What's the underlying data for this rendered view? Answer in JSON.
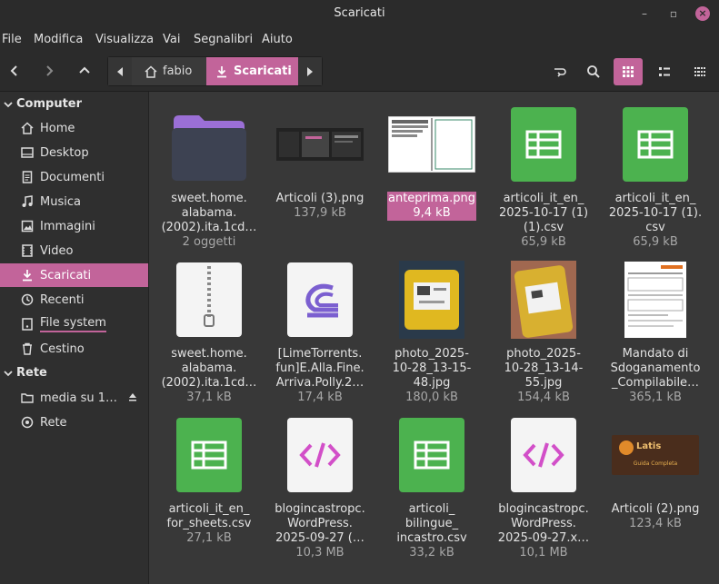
{
  "window": {
    "title": "Scaricati"
  },
  "menu": [
    "File",
    "Modifica",
    "Visualizza",
    "Vai",
    "Segnalibri",
    "Aiuto"
  ],
  "path": {
    "home": "fabio",
    "current": "Scaricati"
  },
  "sidebar": {
    "computer_label": "Computer",
    "items": [
      {
        "label": "Home",
        "icon": "home-icon"
      },
      {
        "label": "Desktop",
        "icon": "desktop-icon"
      },
      {
        "label": "Documenti",
        "icon": "documents-icon"
      },
      {
        "label": "Musica",
        "icon": "music-icon"
      },
      {
        "label": "Immagini",
        "icon": "pictures-icon"
      },
      {
        "label": "Video",
        "icon": "video-icon"
      },
      {
        "label": "Scaricati",
        "icon": "download-icon"
      },
      {
        "label": "Recenti",
        "icon": "recent-icon"
      },
      {
        "label": "File system",
        "icon": "drive-icon"
      },
      {
        "label": "Cestino",
        "icon": "trash-icon"
      }
    ],
    "rete_label": "Rete",
    "rete_items": [
      {
        "label": "media su 1…",
        "icon": "network-share-icon"
      },
      {
        "label": "Rete",
        "icon": "network-icon"
      }
    ]
  },
  "files": [
    {
      "name": "sweet.home.\nalabama.\n(2002).ita.1cd…",
      "info": "2 oggetti",
      "kind": "folder"
    },
    {
      "name": "Articoli (3).png",
      "info": "137,9 kB",
      "kind": "screenshot"
    },
    {
      "name": "anteprima.png",
      "info": "9,4 kB",
      "kind": "preview",
      "selected": true
    },
    {
      "name": "articoli_it_en_\n2025-10-17 (1)\n(1).csv",
      "info": "65,9 kB",
      "kind": "csv"
    },
    {
      "name": "articoli_it_en_\n2025-10-17 (1).\ncsv",
      "info": "65,9 kB",
      "kind": "csv"
    },
    {
      "name": "sweet.home.\nalabama.\n(2002).ita.1cd…",
      "info": "37,1 kB",
      "kind": "zip"
    },
    {
      "name": "[LimeTorrents.\nfun]E.Alla.Fine.\nArriva.Polly.2…",
      "info": "17,4 kB",
      "kind": "torrent"
    },
    {
      "name": "photo_2025-\n10-28_13-15-\n48.jpg",
      "info": "180,0 kB",
      "kind": "photo"
    },
    {
      "name": "photo_2025-\n10-28_13-14-\n55.jpg",
      "info": "154,4 kB",
      "kind": "photo2"
    },
    {
      "name": "Mandato di\nSdoganamento\n_Compilabile…",
      "info": "365,1 kB",
      "kind": "form"
    },
    {
      "name": "articoli_it_en_\nfor_sheets.csv",
      "info": "27,1 kB",
      "kind": "csv"
    },
    {
      "name": "blogincastropc.\nWordPress.\n2025-09-27 (…",
      "info": "10,3 MB",
      "kind": "xml"
    },
    {
      "name": "articoli_\nbilingue_\nincastro.csv",
      "info": "33,2 kB",
      "kind": "csv"
    },
    {
      "name": "blogincastropc.\nWordPress.\n2025-09-27.x…",
      "info": "10,1 MB",
      "kind": "xml"
    },
    {
      "name": "Articoli (2).png",
      "info": "123,4 kB",
      "kind": "banner",
      "banner_text": "Guida Completa",
      "banner_logo": "Latis"
    }
  ],
  "colors": {
    "accent": "#c2649a",
    "csv_green": "#4cb24f",
    "xml_pink": "#d24fc8"
  }
}
